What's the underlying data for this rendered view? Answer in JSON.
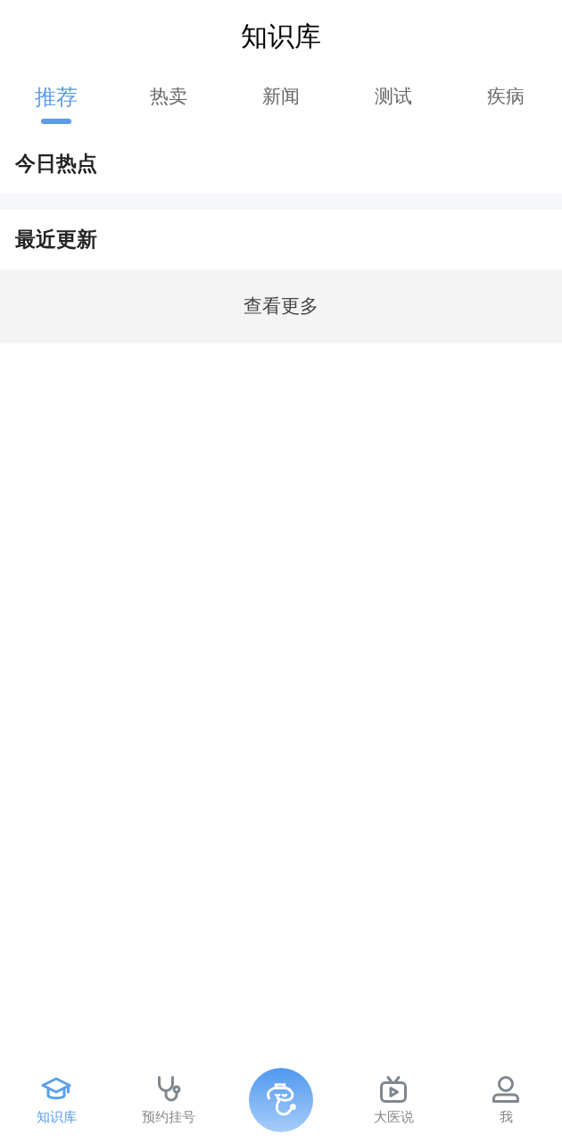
{
  "header": {
    "title": "知识库"
  },
  "tabs": [
    {
      "label": "推荐",
      "selected": true
    },
    {
      "label": "热卖",
      "selected": false
    },
    {
      "label": "新闻",
      "selected": false
    },
    {
      "label": "测试",
      "selected": false
    },
    {
      "label": "疾病",
      "selected": false
    }
  ],
  "sections": [
    {
      "title": "今日热点"
    },
    {
      "title": "最近更新",
      "more": "查看更多"
    }
  ],
  "bottom_nav": [
    {
      "kind": "tab",
      "label": "知识库",
      "selected": true
    },
    {
      "kind": "tab",
      "label": "预约挂号",
      "selected": false
    },
    {
      "kind": "center",
      "selected": false
    },
    {
      "kind": "tab",
      "label": "大医说",
      "selected": false
    },
    {
      "kind": "tab",
      "label": "我",
      "selected": false
    }
  ]
}
